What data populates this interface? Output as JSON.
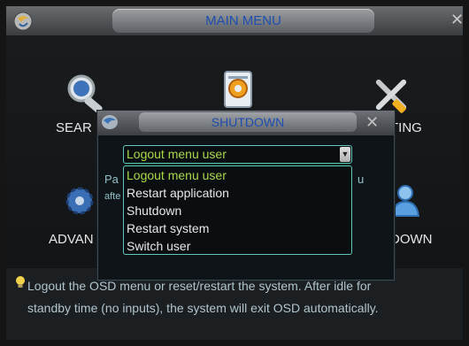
{
  "main_window": {
    "title": "MAIN MENU",
    "close_glyph": "✕",
    "items": [
      {
        "label": "SEAR",
        "icon": "search-icon"
      },
      {
        "label": "",
        "icon": "info-icon"
      },
      {
        "label": "TING",
        "icon": "tools-icon"
      },
      {
        "label": "ADVAN",
        "icon": "advanced-gear-icon"
      },
      {
        "label": "DOWN",
        "icon": "shutdown-user-icon"
      }
    ]
  },
  "dialog": {
    "title": "SHUTDOWN",
    "close_glyph": "✕",
    "partial_text_left_1": "Pa",
    "partial_text_left_2": "afte",
    "partial_text_right": "u",
    "select": {
      "value": "Logout menu user",
      "arrow": "▼",
      "options": [
        "Logout menu user",
        "Restart application",
        "Shutdown",
        "Restart system",
        "Switch user"
      ],
      "selected_index": 0
    }
  },
  "status": {
    "line1": "Logout the OSD menu or reset/restart the system. After idle for",
    "line2": "standby time (no inputs), the system will exit OSD automatically."
  },
  "colors": {
    "title_text": "#1e4fb0",
    "selected_text": "#a8d94a",
    "dropdown_border": "#60c7bb"
  }
}
